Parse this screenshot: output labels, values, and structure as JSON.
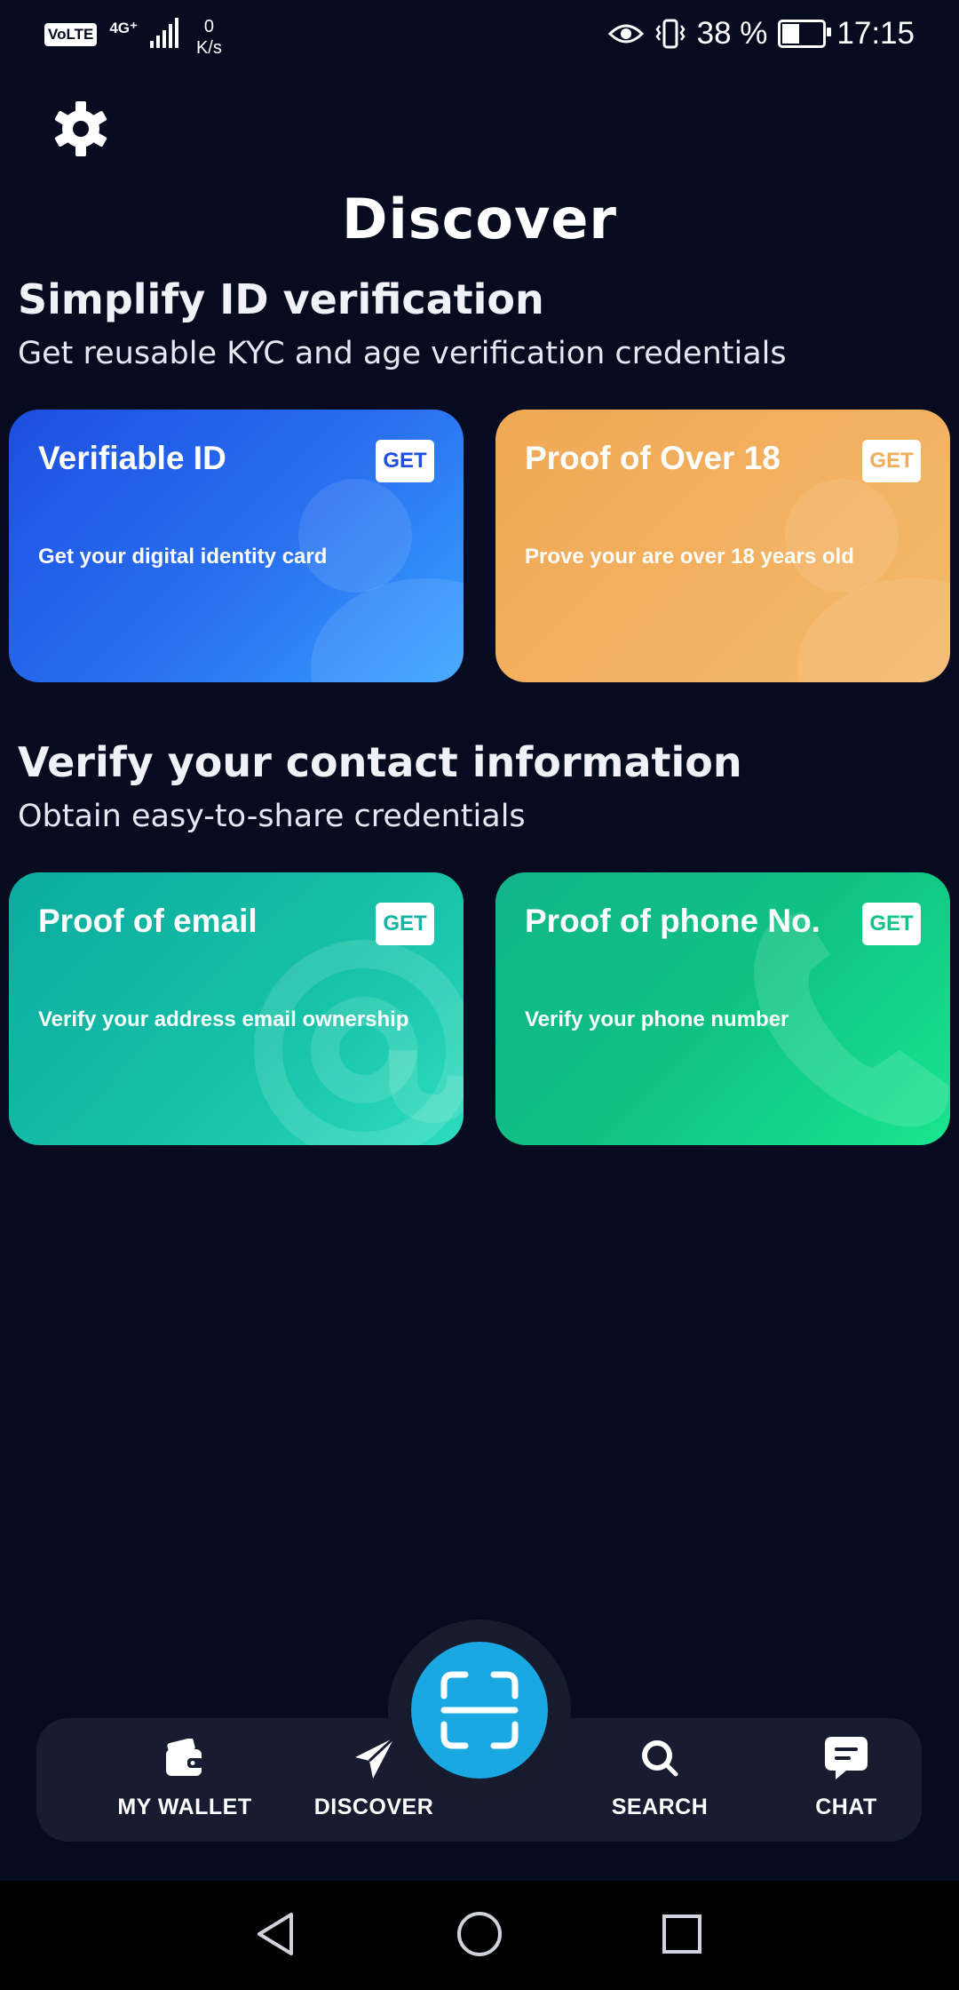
{
  "status_bar": {
    "volte": "VoLTE",
    "network": "4G⁺",
    "speed_value": "0",
    "speed_unit": "K/s",
    "battery_percent": "38 %",
    "battery_level": 0.38,
    "time": "17:15"
  },
  "header": {
    "settings_icon": "gear-icon",
    "title": "Discover"
  },
  "sections": [
    {
      "title": "Simplify ID verification",
      "subtitle": "Get reusable KYC and age verification credentials",
      "cards": [
        {
          "title": "Verifiable ID",
          "description": "Get your digital identity card",
          "button": "GET",
          "accent": "#1d4fe0"
        },
        {
          "title": "Proof of Over 18",
          "description": "Prove your are over 18 years old",
          "button": "GET",
          "accent": "#f0ad5c"
        }
      ]
    },
    {
      "title": "Verify your contact information",
      "subtitle": "Obtain easy-to-share credentials",
      "cards": [
        {
          "title": "Proof of email",
          "description": "Verify your address email ownership",
          "button": "GET",
          "accent": "#12b5a3",
          "icon": "at-sign-icon"
        },
        {
          "title": "Proof of phone No.",
          "description": "Verify your phone number",
          "button": "GET",
          "accent": "#12c488",
          "icon": "phone-icon"
        }
      ]
    }
  ],
  "bottom_nav": {
    "items": [
      {
        "label": "MY WALLET",
        "icon": "wallet-icon"
      },
      {
        "label": "DISCOVER",
        "icon": "paper-plane-icon",
        "active": true
      },
      {
        "label": "SEARCH",
        "icon": "search-icon"
      },
      {
        "label": "CHAT",
        "icon": "chat-icon"
      }
    ],
    "scan_icon": "scan-icon",
    "scan_color": "#1aa8e3"
  },
  "colors": {
    "background": "#060b1f",
    "nav_background": "#171c30"
  }
}
